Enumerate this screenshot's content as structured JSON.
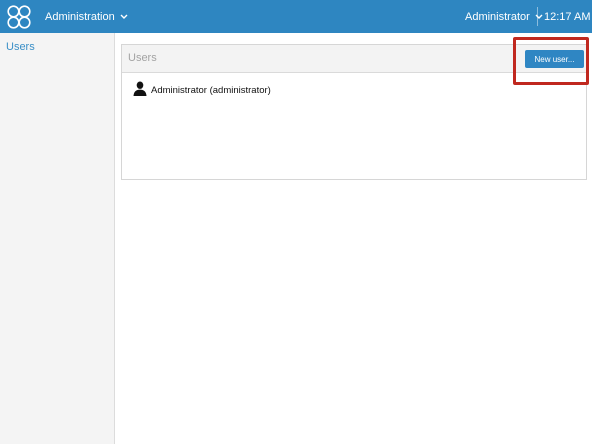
{
  "header": {
    "app_menu_label": "Administration",
    "user_menu_label": "Administrator",
    "clock": "12:17 AM"
  },
  "sidebar": {
    "items": [
      {
        "label": "Users"
      }
    ]
  },
  "users_panel": {
    "title": "Users",
    "new_user_label": "New user...",
    "users": [
      {
        "label": "Administrator (administrator)"
      }
    ]
  },
  "colors": {
    "header_bg": "#2e86c1",
    "accent": "#2f86c3",
    "link": "#3a8fc7",
    "highlight": "#c0281f"
  },
  "icons": {
    "logo": "four-circles-logo-icon",
    "dropdown": "chevron-down-icon",
    "user": "user-silhouette-icon"
  }
}
